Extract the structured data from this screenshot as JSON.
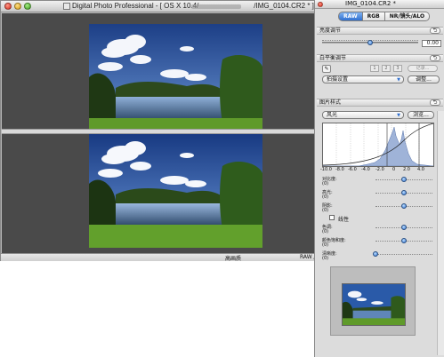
{
  "main_window": {
    "title": "Digital Photo Professional - [ OS X 10.4/",
    "title_suffix": "/IMG_0104.CR2 * ]",
    "status_quality": "高画质",
    "status_mode": "RAW /"
  },
  "palette": {
    "title": "IMG_0104.CR2 *",
    "tabs": [
      "RAW",
      "RGB",
      "NR/镜头/ALO"
    ],
    "brightness": {
      "header": "亮度调节",
      "value": "0.00",
      "level": 0.5
    },
    "white_balance": {
      "header": "白平衡调节",
      "dropper_icon": "eyedropper-icon",
      "numbers": [
        "1",
        "2",
        "3"
      ],
      "register_label": "记录...",
      "preset": "拍摄设置",
      "adjust_label": "调整..."
    },
    "picture_style": {
      "header": "图片样式",
      "preset": "风光",
      "browse_label": "浏览...",
      "histogram_ticks": [
        "-10.0",
        "-8.0",
        "-6.0",
        "-4.0",
        "-2.0",
        "0",
        "2.0",
        "4.0"
      ],
      "adjustments": [
        {
          "label": "对比度:",
          "value": "(0)",
          "level": 0.5
        },
        {
          "label": "高光:",
          "value": "(0)",
          "level": 0.5
        },
        {
          "label": "阴影:",
          "value": "(0)",
          "level": 0.5
        },
        {
          "label": "色调:",
          "value": "(0)",
          "level": 0.5
        },
        {
          "label": "颜色饱和度:",
          "value": "(0)",
          "level": 0.5
        },
        {
          "label": "清晰度:",
          "value": "(0)",
          "level": 0.0
        }
      ],
      "monochrome_label": "线性"
    },
    "reset_glyph": "⮌"
  },
  "colors": {
    "accent": "#2f6fd0",
    "pane_bg": "#4a4a4a",
    "sky_top": "#1d3f86",
    "sky_bottom": "#6f9ad8",
    "foliage": "#2d4a1c",
    "grass": "#5f9a2a"
  }
}
